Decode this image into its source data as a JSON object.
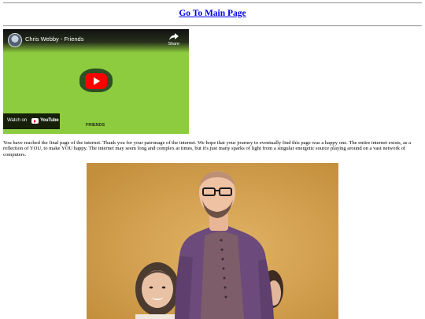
{
  "header": {
    "main_link": "Go To Main Page"
  },
  "video": {
    "title": "Chris Webby - Friends",
    "share_label": "Share",
    "watch_on_label": "Watch on",
    "watch_on_brand": "YouTube",
    "thumbnail_caption": "FRIENDS",
    "accent_color": "#ff0000",
    "background_color": "#8dcc3f",
    "icons": [
      "avatar",
      "share-icon",
      "play-icon",
      "youtube-logo-icon"
    ]
  },
  "body": {
    "message": "You have reached the final page of the internet. Thank you for your patronage of the internet. We hope that your journey to eventually find this page was a happy one. The entire internet exists, as a reflection of YOU, to make YOU happy. The internet may seem long and complex at times, but it's just many sparks of light from a singular energetic source playing around on a vast network of computers."
  },
  "colors": {
    "link": "#0000ee",
    "photo_background": "#d7a657",
    "robe": "#6c4a7c"
  }
}
